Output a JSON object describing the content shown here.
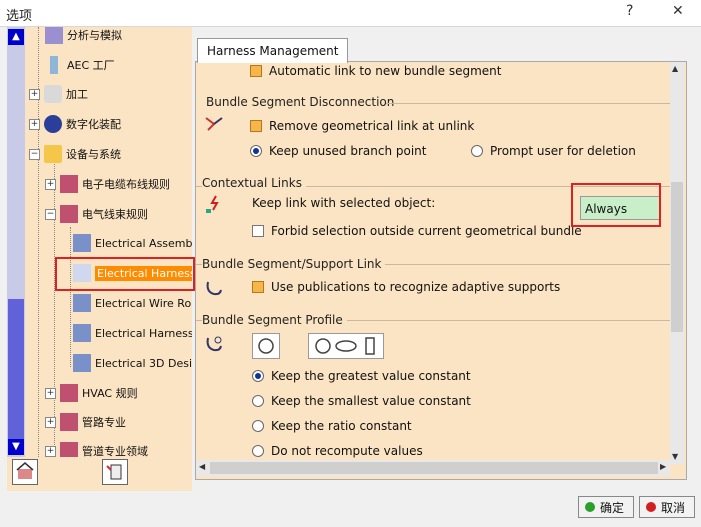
{
  "window": {
    "title": "选项",
    "help": "?",
    "close": "✕"
  },
  "tree": {
    "items": [
      {
        "label": "分析与模拟"
      },
      {
        "label": "AEC 工厂"
      },
      {
        "label": "加工"
      },
      {
        "label": "数字化装配"
      },
      {
        "label": "设备与系统"
      },
      {
        "label": "电子电缆布线规则"
      },
      {
        "label": "电气线束规则"
      },
      {
        "label": "Electrical Assemb"
      },
      {
        "label": "Electrical Harness"
      },
      {
        "label": "Electrical Wire Ro"
      },
      {
        "label": "Electrical Harness"
      },
      {
        "label": "Electrical 3D Desi"
      },
      {
        "label": "HVAC 规则"
      },
      {
        "label": "管路专业"
      },
      {
        "label": "管道专业领域"
      }
    ]
  },
  "tabs": [
    {
      "label": "Harness Management"
    }
  ],
  "options": {
    "auto_link": "Automatic link to new bundle segment",
    "disconnection": {
      "title": "Bundle Segment Disconnection",
      "remove_link": "Remove geometrical link at unlink",
      "keep_branch": "Keep unused branch point",
      "prompt_user": "Prompt user for deletion"
    },
    "contextual": {
      "title": "Contextual Links",
      "keep_link_label": "Keep link with selected object:",
      "keep_link_value": "Always",
      "forbid_selection": "Forbid selection outside current geometrical bundle"
    },
    "support": {
      "title": "Bundle Segment/Support Link",
      "use_publications": "Use publications to recognize adaptive supports"
    },
    "profile": {
      "title": "Bundle Segment Profile",
      "greatest": "Keep the greatest value constant",
      "smallest": "Keep the smallest value constant",
      "ratio": "Keep the ratio constant",
      "no_recompute": "Do not recompute values"
    }
  },
  "buttons": {
    "ok": "确定",
    "cancel": "取消"
  },
  "colors": {
    "tree_bg": "#fbe4c3",
    "selected": "#ff8c00",
    "highlight": "#e02020",
    "combo_bg": "#c8efc8"
  }
}
